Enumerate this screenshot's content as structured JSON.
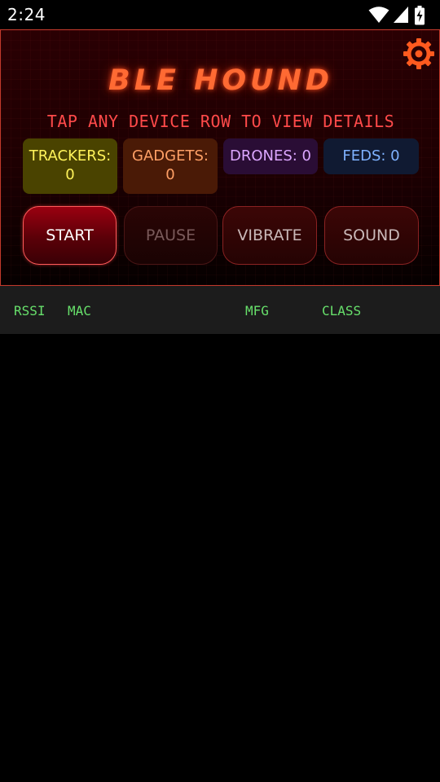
{
  "status_bar": {
    "time": "2:24",
    "icons": [
      "wifi-icon",
      "cell-signal-icon",
      "battery-charging-icon"
    ]
  },
  "header": {
    "title": "BLE HOUND",
    "instruction": "TAP ANY DEVICE ROW TO VIEW DETAILS",
    "settings_icon": "gear-icon",
    "accent_color": "#ff6a33"
  },
  "counters": {
    "trackers": {
      "label": "TRACKERS:",
      "value": "0",
      "color": "#fff35a"
    },
    "gadgets": {
      "label": "GADGETS:",
      "value": "0",
      "color": "#ffa066"
    },
    "drones": {
      "label": "DRONES: 0",
      "color": "#dca6ff"
    },
    "feds": {
      "label": "FEDS: 0",
      "color": "#7fb2ff"
    }
  },
  "buttons": {
    "start": "START",
    "pause": "PAUSE",
    "vibrate": "VIBRATE",
    "sound": "SOUND"
  },
  "table": {
    "columns": [
      "RSSI",
      "MAC",
      "MFG",
      "CLASS"
    ],
    "rows": []
  }
}
